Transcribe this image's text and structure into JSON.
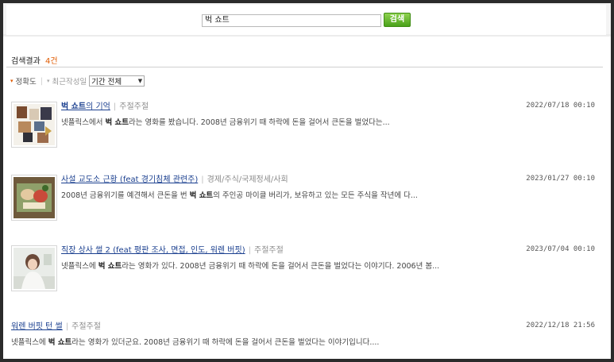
{
  "search": {
    "query": "벅 쇼트",
    "button_label": "검색"
  },
  "results_header": {
    "label": "검색결과",
    "count": "4건"
  },
  "sort": {
    "accuracy": "정확도",
    "recent": "최근작성일",
    "period_selected": "기간 전체"
  },
  "results": [
    {
      "title_pre": "",
      "title_keyword": "벅 쇼트",
      "title_post": "의 기억",
      "category": "주절주절",
      "date": "2022/07/18 00:10",
      "snippet_pre": "넷플릭스에서 ",
      "snippet_keyword": "벅 쇼트",
      "snippet_post": "라는 영화를 봤습니다. 2008년 금융위기 때 하락에 돈을 걸어서 큰돈을 벌었다는..."
    },
    {
      "title_pre": "사설 교도소 근황 (feat 경기침체 관련주)",
      "title_keyword": "",
      "title_post": "",
      "category": "경제/주식/국제정세/사회",
      "date": "2023/01/27 00:10",
      "snippet_pre": "2008년 금융위기를 예견해서 큰돈을 번 ",
      "snippet_keyword": "벅 쇼트",
      "snippet_post": "의 주인공 마이클 버리가, 보유하고 있는 모든 주식을 작년에 다..."
    },
    {
      "title_pre": "직장 상사 썰 2 (feat 평판 조사, 면접, 인도, 워렌 버핏)",
      "title_keyword": "",
      "title_post": "",
      "category": "주절주절",
      "date": "2023/07/04 00:10",
      "snippet_pre": "넷플릭스에 ",
      "snippet_keyword": "벅 쇼트",
      "snippet_post": "라는 영화가 있다. 2008년 금융위기 때 하락에 돈을 걸어서 큰돈을 벌었다는 이야기다. 2006년 봄..."
    },
    {
      "title_pre": "워렌 버핏 턴 썰",
      "title_keyword": "",
      "title_post": "",
      "category": "주절주절",
      "date": "2022/12/18 21:56",
      "snippet_pre": "넷플릭스에 ",
      "snippet_keyword": "벅 쇼트",
      "snippet_post": "라는 영화가 있더군요. 2008년 금융위기 때 하락에 돈을 걸어서 큰돈을 벌었다는 이야기입니다...."
    }
  ]
}
